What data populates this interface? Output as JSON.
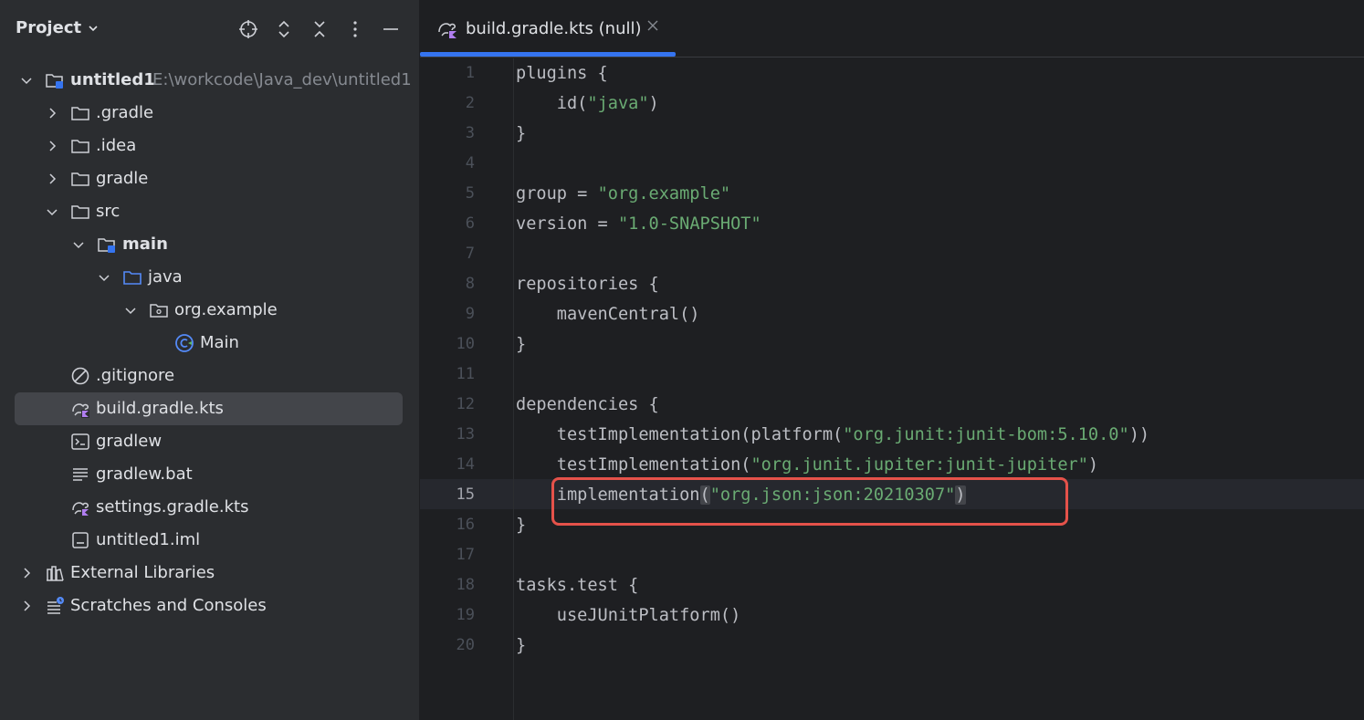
{
  "project_panel": {
    "title": "Project",
    "tree": [
      {
        "label": "untitled1",
        "path": "E:\\workcode\\Java_dev\\untitled1"
      },
      {
        "label": ".gradle"
      },
      {
        "label": ".idea"
      },
      {
        "label": "gradle"
      },
      {
        "label": "src"
      },
      {
        "label": "main"
      },
      {
        "label": "java"
      },
      {
        "label": "org.example"
      },
      {
        "label": "Main"
      },
      {
        "label": ".gitignore"
      },
      {
        "label": "build.gradle.kts"
      },
      {
        "label": "gradlew"
      },
      {
        "label": "gradlew.bat"
      },
      {
        "label": "settings.gradle.kts"
      },
      {
        "label": "untitled1.iml"
      },
      {
        "label": "External Libraries"
      },
      {
        "label": "Scratches and Consoles"
      }
    ]
  },
  "editor": {
    "tab": {
      "label": "build.gradle.kts (null)"
    },
    "current_line": 15,
    "lines": [
      {
        "num": "1",
        "text": "plugins {"
      },
      {
        "num": "2",
        "pre": "    id(",
        "str": "\"java\"",
        "post": ")"
      },
      {
        "num": "3",
        "text": "}"
      },
      {
        "num": "4",
        "text": ""
      },
      {
        "num": "5",
        "pre": "group = ",
        "str": "\"org.example\"",
        "post": ""
      },
      {
        "num": "6",
        "pre": "version = ",
        "str": "\"1.0-SNAPSHOT\"",
        "post": ""
      },
      {
        "num": "7",
        "text": ""
      },
      {
        "num": "8",
        "text": "repositories {"
      },
      {
        "num": "9",
        "text": "    mavenCentral()"
      },
      {
        "num": "10",
        "text": "}"
      },
      {
        "num": "11",
        "text": ""
      },
      {
        "num": "12",
        "text": "dependencies {"
      },
      {
        "num": "13",
        "pre": "    testImplementation(platform(",
        "str": "\"org.junit:junit-bom:5.10.0\"",
        "post": "))"
      },
      {
        "num": "14",
        "pre": "    testImplementation(",
        "str": "\"org.junit.jupiter:junit-jupiter\"",
        "post": ")"
      },
      {
        "num": "15",
        "pre": "    implementation",
        "open": "(",
        "str": "\"org.json:json:20210307\"",
        "close": ")"
      },
      {
        "num": "16",
        "text": "}"
      },
      {
        "num": "17",
        "text": ""
      },
      {
        "num": "18",
        "text": "tasks.test {"
      },
      {
        "num": "19",
        "text": "    useJUnitPlatform()"
      },
      {
        "num": "20",
        "text": "}"
      }
    ]
  },
  "colors": {
    "accent": "#3574f0",
    "string": "#6aab73",
    "highlight_box": "#e5524a",
    "selected_row": "#43454a"
  }
}
